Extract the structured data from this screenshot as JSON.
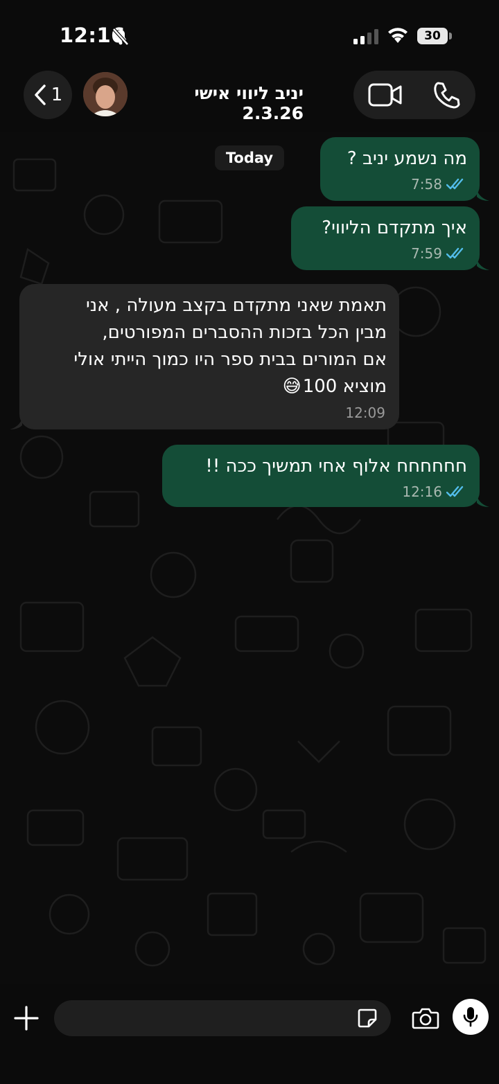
{
  "status_bar": {
    "time": "12:16",
    "battery": "30"
  },
  "header": {
    "back_count": "1",
    "contact_name": "יניב ליווי אישי 2.3.26"
  },
  "date_chip": "Today",
  "messages": [
    {
      "direction": "outgoing",
      "text": "מה נשמע יניב ?",
      "time": "7:58",
      "read": true
    },
    {
      "direction": "outgoing",
      "text": "איך מתקדם הליווי?",
      "time": "7:59",
      "read": true
    },
    {
      "direction": "incoming",
      "lines": [
        "תאמת שאני מתקדם  בקצב מעולה , אני",
        "מבין הכל בזכות ההסברים המפורטים,",
        "אם המורים בבית ספר היו כמוך הייתי אולי",
        "מוציא 100"
      ],
      "emoji": "😅",
      "time": "12:09"
    },
    {
      "direction": "outgoing",
      "text": "חחחחחח אלוף אחי תמשיך ככה !!",
      "time": "12:16",
      "read": true
    }
  ],
  "colors": {
    "outgoing_bubble": "#144d37",
    "incoming_bubble": "#262626",
    "read_ticks": "#53bdeb"
  }
}
